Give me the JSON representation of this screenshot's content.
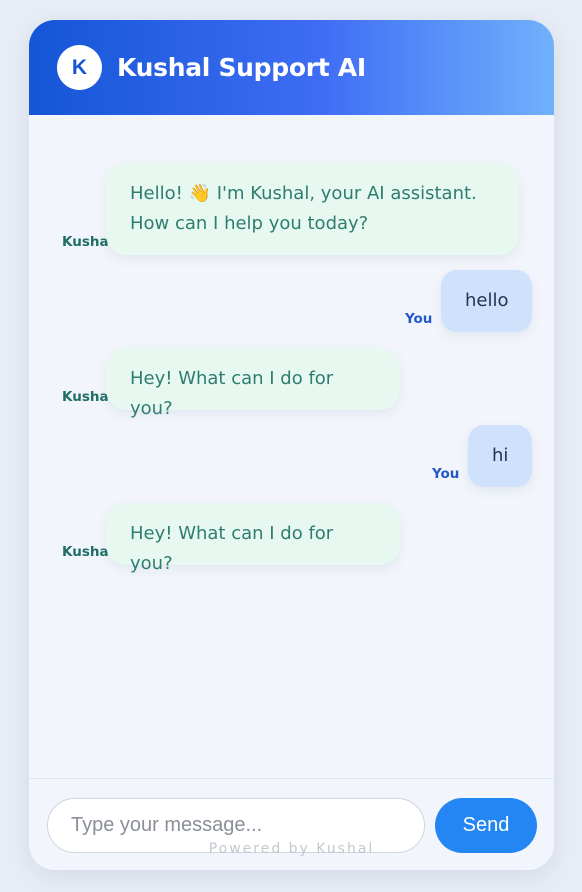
{
  "header": {
    "avatar_letter": "K",
    "title": "Kushal Support AI"
  },
  "messages": [
    {
      "sender": "bot",
      "label": "Kushal",
      "lines": [
        "Hello! 👋 I'm Kushal, your AI assistant.",
        "How can I help you today?"
      ]
    },
    {
      "sender": "user",
      "label": "You",
      "lines": [
        "hello"
      ]
    },
    {
      "sender": "bot",
      "label": "Kushal",
      "lines": [
        "Hey! What can I do for you?"
      ]
    },
    {
      "sender": "user",
      "label": "You",
      "lines": [
        "hi"
      ]
    },
    {
      "sender": "bot",
      "label": "Kushal",
      "lines": [
        "Hey! What can I do for you?"
      ]
    }
  ],
  "composer": {
    "placeholder": "Type your message...",
    "value": "",
    "send_label": "Send"
  },
  "footer": {
    "powered_by": "Powered by Kushal"
  },
  "colors": {
    "header_start": "#1456d6",
    "header_end": "#70b1fb",
    "bot_bubble": "#e7f8f1",
    "user_bubble": "#cfe1fb",
    "send_button": "#2486f2"
  }
}
